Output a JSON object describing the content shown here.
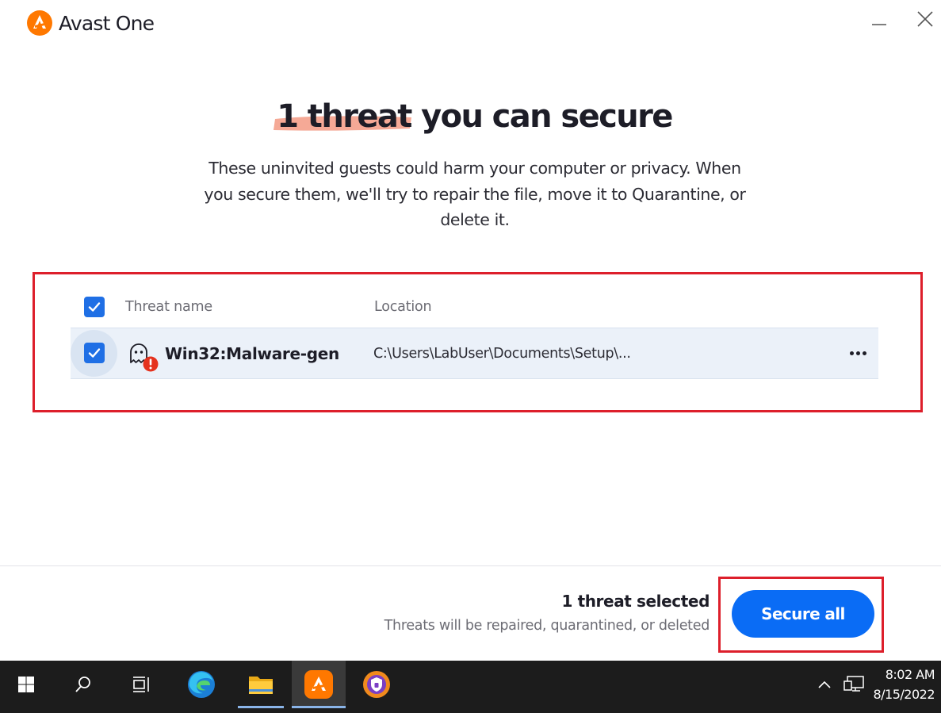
{
  "app": {
    "name": "Avast One",
    "brand_color": "#ff7800"
  },
  "window_controls": {
    "minimize_icon": "minimize-icon",
    "close_icon": "close-icon"
  },
  "header": {
    "highlight": "1 threat",
    "title_rest": " you can secure",
    "description": "These uninvited guests could harm your computer or privacy. When you secure them, we'll try to repair the file, move it to Quarantine, or delete it."
  },
  "table": {
    "columns": [
      "Threat name",
      "Location"
    ],
    "select_all_checked": true,
    "rows": [
      {
        "checked": true,
        "icon": "ghost-alert-icon",
        "name": "Win32:Malware-gen",
        "location": "C:\\Users\\LabUser\\Documents\\Setup\\..."
      }
    ]
  },
  "footer": {
    "selected_label": "1 threat selected",
    "note": "Threats will be repaired, quarantined, or deleted",
    "secure_button": "Secure all"
  },
  "taskbar": {
    "apps": [
      "start",
      "search",
      "task-view",
      "edge",
      "file-explorer",
      "avast-one",
      "avast-secure-browser"
    ],
    "active": "avast-one",
    "time": "8:02 AM",
    "date": "8/15/2022"
  },
  "colors": {
    "accent_blue": "#0a6cf5",
    "checkbox_blue": "#1f6fe5",
    "highlight_brush": "#f4a08b",
    "annotation_red": "#dd1f2b",
    "alert_red": "#e5321e"
  }
}
